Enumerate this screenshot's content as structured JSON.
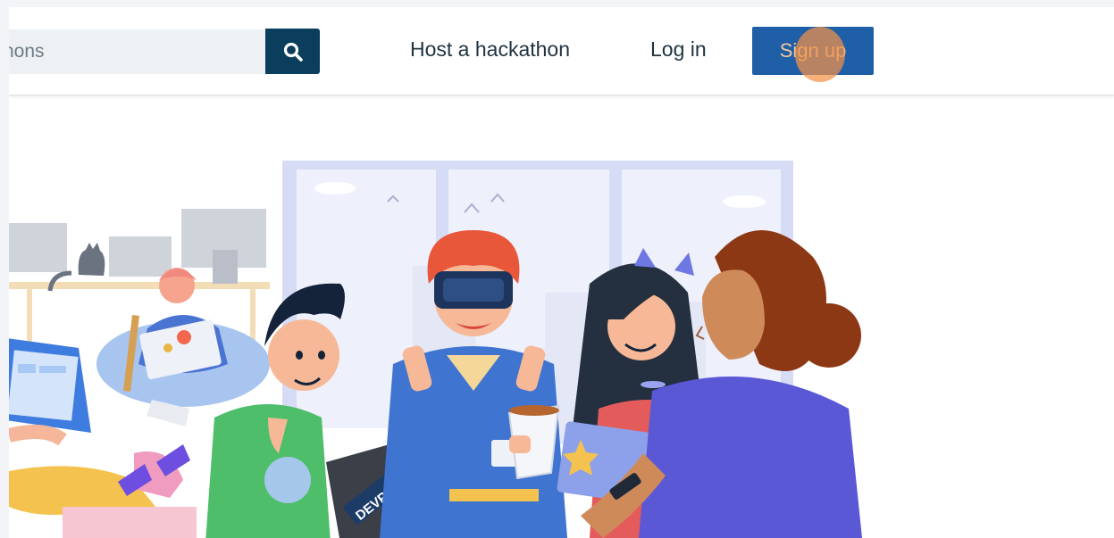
{
  "header": {
    "search": {
      "placeholder": "hons"
    },
    "host_label": "Host a hackathon",
    "login_label": "Log in",
    "signup_label": "Sign up"
  },
  "hero": {
    "illustration": "hackathon-people-illustration",
    "laptop_sticker": "DEVPOST",
    "sticker_small": "DEVPOST"
  },
  "colors": {
    "nav_text": "#1f3340",
    "search_button": "#0b3d5c",
    "signup_button": "#1e5fa8",
    "click_indicator": "#f39246"
  }
}
